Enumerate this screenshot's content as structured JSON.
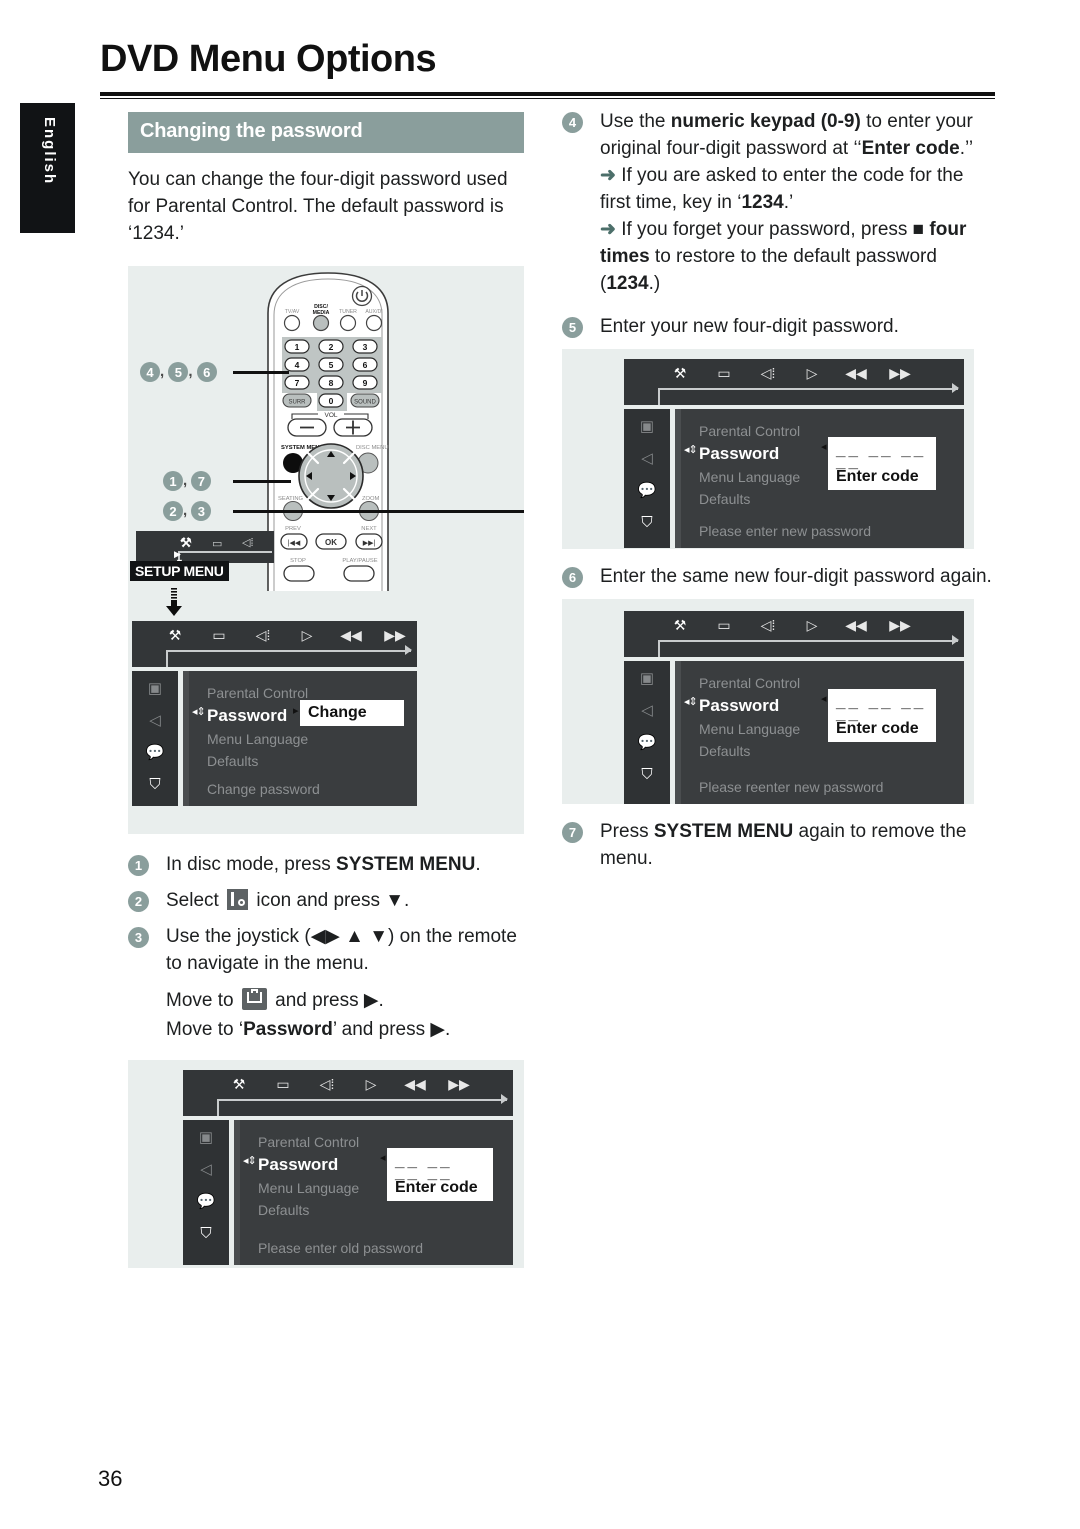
{
  "page": {
    "title": "DVD Menu Options",
    "language_tab": "English",
    "page_number": "36"
  },
  "section": {
    "heading": "Changing the password",
    "intro": "You can change the four-digit password used for Parental Control. The default password is ‘1234.’"
  },
  "left_steps": [
    {
      "num": "1",
      "text_before": "In disc mode, press ",
      "bold": "SYSTEM MENU",
      "text_after": "."
    },
    {
      "num": "2",
      "text_before": "Select ",
      "icon": "setup-menu-icon",
      "text_after": " icon and press ▼."
    },
    {
      "num": "3",
      "text_before": "Use the joystick (◀▶ ▲ ▼) on the remote to navigate in the menu."
    }
  ],
  "left_substeps": [
    {
      "text_before": "Move to ",
      "icon": "preference-case-icon",
      "text_after": " and press ▶."
    },
    {
      "text_before": "Move to ‘",
      "bold": "Password",
      "text_after": "’ and press ▶."
    }
  ],
  "right_steps": [
    {
      "num": "4",
      "line1_a": "Use the ",
      "line1_bold": "numeric keypad (0-9)",
      "line1_b": " to enter your original four-digit password at ‘‘",
      "line1_bold2": "Enter code",
      "line1_c": ".’’",
      "arrow1_a": "If you are asked to enter the code for the first time, key in ‘",
      "arrow1_bold": "1234",
      "arrow1_b": ".’",
      "arrow2_a": "If you forget your password, press ",
      "arrow2_sq": "■",
      "arrow2_bold": " four times",
      "arrow2_b": " to restore to the default password (",
      "arrow2_bold2": "1234",
      "arrow2_c": ".)"
    },
    {
      "num": "5",
      "text": "Enter your new four-digit password."
    },
    {
      "num": "6",
      "text": "Enter the same new four-digit password again."
    },
    {
      "num": "7",
      "text_before": "Press ",
      "bold": "SYSTEM MENU",
      "text_after": " again to remove the menu."
    }
  ],
  "setup_mini": {
    "label": "SETUP MENU",
    "icons": [
      "setup-tools-icon",
      "tv-screen-icon",
      "speaker-icon"
    ]
  },
  "osd_topbar_icons": [
    "setup-tools-icon",
    "tv-screen-icon",
    "speaker-icon",
    "play-icon",
    "rewind-icon",
    "forward-icon"
  ],
  "osd_rail_icons": [
    "disc-icon",
    "speaker-icon",
    "subtitle-icon",
    "preference-case-icon"
  ],
  "osd_screens": [
    {
      "name": "change-password-screen",
      "items": [
        "Parental Control",
        "Password",
        "Menu Language",
        "Defaults"
      ],
      "selected": "Password",
      "value_label": "Change",
      "value_dashes": "",
      "hint": "Change  password"
    },
    {
      "name": "enter-old-password-screen",
      "items": [
        "Parental Control",
        "Password",
        "Menu Language",
        "Defaults"
      ],
      "selected": "Password",
      "value_label": "Enter code",
      "value_dashes": "__ __ __ __",
      "hint": "Please enter old password"
    },
    {
      "name": "enter-new-password-screen",
      "items": [
        "Parental Control",
        "Password",
        "Menu Language",
        "Defaults"
      ],
      "selected": "Password",
      "value_label": "Enter code",
      "value_dashes": "__ __ __ __",
      "hint": "Please enter new password"
    },
    {
      "name": "reenter-new-password-screen",
      "items": [
        "Parental Control",
        "Password",
        "Menu Language",
        "Defaults"
      ],
      "selected": "Password",
      "value_label": "Enter code",
      "value_dashes": "__ __ __ __",
      "hint": "Please reenter new password"
    }
  ],
  "remote": {
    "source_buttons": [
      "TV/AV",
      "DISC/ MEDIA",
      "TUNER",
      "AUX/DI"
    ],
    "standby_icon": "power-icon",
    "keypad": [
      "1",
      "2",
      "3",
      "4",
      "5",
      "6",
      "7",
      "8",
      "9",
      "0"
    ],
    "surround_button": "SURR",
    "sound_button": "SOUND",
    "vol_label": "VOL",
    "vol_minus": "−",
    "vol_plus": "+",
    "system_menu_label": "SYSTEM MENU",
    "disc_menu_label": "DISC MENU",
    "seating_label": "SEATING",
    "zoom_label": "ZOOM",
    "prev_label": "PREV",
    "next_label": "NEXT",
    "ok_label": "OK",
    "stop_label": "STOP",
    "play_pause_label": "PLAY/PAUSE",
    "callouts": [
      {
        "name": "keypad-callout",
        "nums": [
          "4",
          "5",
          "6"
        ]
      },
      {
        "name": "system-menu-callout",
        "nums": [
          "1",
          "7"
        ]
      },
      {
        "name": "joystick-callout",
        "nums": [
          "2",
          "3"
        ]
      }
    ]
  },
  "colors": {
    "accent": "#8a9e9c",
    "panel_bg": "#e9eeed",
    "osd_dark": "#333638",
    "osd_panel": "#3a3d3f",
    "black": "#111315"
  }
}
